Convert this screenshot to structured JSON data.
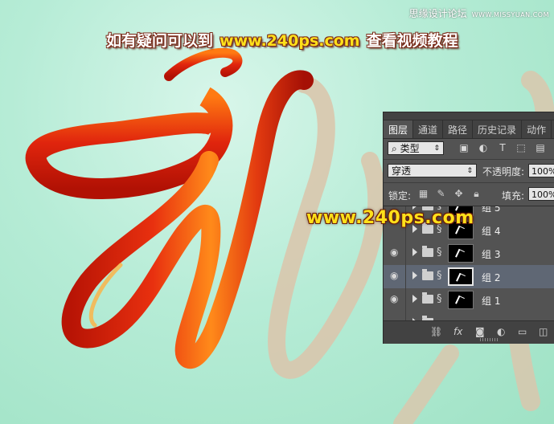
{
  "header": {
    "site_name": "思缘设计论坛",
    "site_url": "WWW.MISSYUAN.COM"
  },
  "banner": {
    "prefix": "如有疑问可以到",
    "url": "www.240ps.com",
    "suffix": "查看视频教程"
  },
  "watermark": "www.240ps.com",
  "panel": {
    "tabs": [
      {
        "label": "图层",
        "active": true
      },
      {
        "label": "通道"
      },
      {
        "label": "路径"
      },
      {
        "label": "历史记录"
      },
      {
        "label": "动作"
      }
    ],
    "filter": {
      "search_glyph": "⌕",
      "label": "类型",
      "caret": "⇕"
    },
    "filter_icons": [
      "image-filter-icon",
      "adjustment-filter-icon",
      "type-filter-icon",
      "shape-filter-icon",
      "smart-object-filter-icon"
    ],
    "blend": {
      "mode": "穿透",
      "caret": "⇕",
      "opacity_label": "不透明度:",
      "opacity_value": "100%"
    },
    "lock": {
      "label": "锁定:",
      "fill_label": "填充:",
      "fill_value": "100%"
    },
    "layers": [
      {
        "name": "组 5",
        "visible": false,
        "selected": false
      },
      {
        "name": "组 4",
        "visible": false,
        "selected": false
      },
      {
        "name": "组 3",
        "visible": true,
        "selected": false
      },
      {
        "name": "组 2",
        "visible": true,
        "selected": true
      },
      {
        "name": "组 1",
        "visible": true,
        "selected": false
      }
    ],
    "footer_icons": [
      "link-layers-icon",
      "fx-icon",
      "add-mask-icon",
      "adjustment-layer-icon",
      "new-group-icon",
      "new-layer-icon"
    ],
    "fx_label": "fx"
  },
  "colors": {
    "canvas_background": "#b6ecd6",
    "ribbon_red": "#d8240e",
    "ribbon_orange": "#ff8a1a",
    "shadow_tan": "#d9c7ad",
    "panel_bg": "#535353",
    "selected_layer": "#5f6774",
    "watermark_yellow": "#ffe01a"
  }
}
